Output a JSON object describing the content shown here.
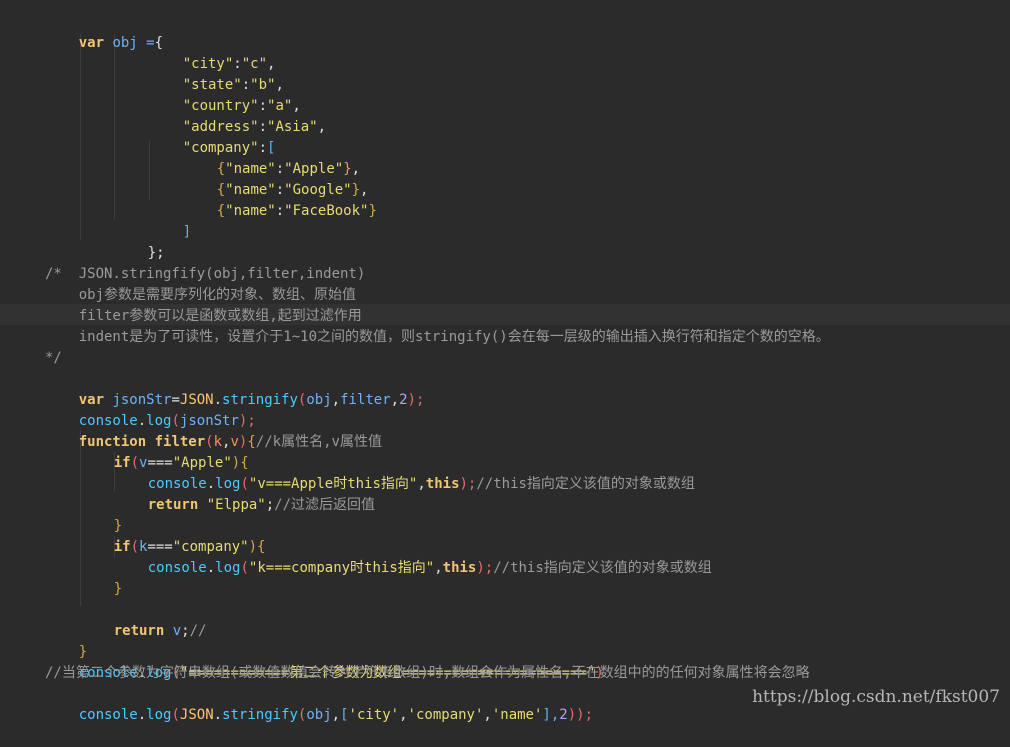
{
  "code": {
    "l1": [
      "var",
      " obj =",
      "{"
    ],
    "l2": [
      "\"city\"",
      ":",
      "\"c\"",
      ","
    ],
    "l3": [
      "\"state\"",
      ":",
      "\"b\"",
      ","
    ],
    "l4": [
      "\"country\"",
      ":",
      "\"a\"",
      ","
    ],
    "l5": [
      "\"address\"",
      ":",
      "\"Asia\"",
      ","
    ],
    "l6": [
      "\"company\"",
      ":",
      "["
    ],
    "l7": [
      "{",
      "\"name\"",
      ":",
      "\"Apple\"",
      "}",
      ","
    ],
    "l8": [
      "{",
      "\"name\"",
      ":",
      "\"Google\"",
      "}",
      ","
    ],
    "l9": [
      "{",
      "\"name\"",
      ":",
      "\"FaceBook\"",
      "}"
    ],
    "l10": [
      "]"
    ],
    "l11": [
      "};"
    ],
    "l13": [
      "/*  JSON.stringfify(obj,filter,indent)"
    ],
    "l14": [
      "    obj参数是需要序列化的对象、数组、原始值"
    ],
    "l15": [
      "    filter参数可以是函数或数组,起到过滤作用"
    ],
    "l16": [
      "    indent是为了可读性，设置介于1~10之间的数值，则stringify()会在每一层级的输出插入换行符和指定个数的空格。"
    ],
    "l17": [
      "*/"
    ],
    "l18": [
      "var",
      " jsonStr",
      "=",
      "JSON",
      ".",
      "stringify",
      "(",
      "obj",
      ",",
      "filter",
      ",",
      "2",
      ");"
    ],
    "l19": [
      "console",
      ".",
      "log",
      "(",
      "jsonStr",
      ");"
    ],
    "l20": [
      "function",
      " filter",
      "(",
      "k",
      ",",
      "v",
      ")",
      "{",
      "//k属性名,v属性值"
    ],
    "l21": [
      "if",
      "(",
      "v",
      "===",
      "\"Apple\"",
      "){"
    ],
    "l22": [
      "console",
      ".",
      "log",
      "(",
      "\"v===Apple时this指向\"",
      ",",
      "this",
      ");",
      "//this指向定义该值的对象或数组"
    ],
    "l23": [
      "return",
      " \"Elppa\"",
      ";",
      "//过滤后返回值"
    ],
    "l24": [
      "}"
    ],
    "l25": [
      "if",
      "(",
      "k",
      "===",
      "\"company\"",
      "){"
    ],
    "l26": [
      "console",
      ".",
      "log",
      "(",
      "\"k===company时this指向\"",
      ",",
      "this",
      ");",
      "//this指向定义该值的对象或数组"
    ],
    "l27": [
      "}"
    ],
    "l29": [
      "return",
      " v",
      ";",
      "//"
    ],
    "l30": [
      "}"
    ],
    "l31": [
      "console",
      ".",
      "log",
      "(",
      "\"============第二个参数为数组======================\"",
      ")"
    ],
    "l32": [
      "//当第二个参数为字符串数组(或数值数值会转为字符串数组)时,数组会作为属性名,不在数组中的的任何对象属性将会忽略"
    ],
    "l33": [
      "console",
      ".",
      "log",
      "(",
      "JSON",
      ".",
      "stringify",
      "(",
      "obj",
      ",",
      "[",
      "'city'",
      ",",
      "'company'",
      ",",
      "'name'",
      "],",
      "2",
      "));"
    ]
  },
  "watermark": "https://blog.csdn.net/fkst007"
}
